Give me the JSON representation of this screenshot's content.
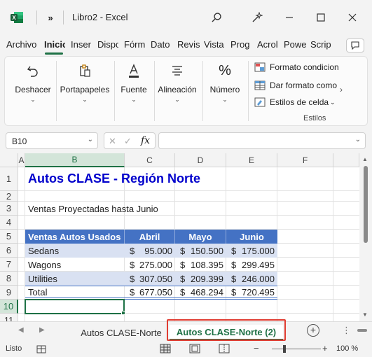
{
  "window": {
    "more_label": "»",
    "title": "Libro2  -  Excel",
    "app_icon_letter": "X"
  },
  "menu": {
    "tabs": [
      "Archivo",
      "Inicio",
      "Inser",
      "Dispo",
      "Fórm",
      "Dato",
      "Revis",
      "Vista",
      "Prog",
      "Acrol",
      "Powe",
      "Scrip"
    ],
    "active": "Inicio"
  },
  "ribbon": {
    "groups": [
      {
        "label": "Deshacer",
        "icon": "undo-icon"
      },
      {
        "label": "Portapapeles",
        "icon": "clipboard-icon"
      },
      {
        "label": "Fuente",
        "icon": "font-color-icon"
      },
      {
        "label": "Alineación",
        "icon": "align-icon"
      },
      {
        "label": "Número",
        "icon": "percent-icon"
      }
    ],
    "styles": {
      "conditional_format": "Formato condicion",
      "format_as_table": "Dar formato como",
      "cell_styles": "Estilos de celda",
      "caption": "Estilos"
    }
  },
  "formula_bar": {
    "name_box": "B10",
    "fx": "fx",
    "cancel": "✕",
    "enter": "✓",
    "formula": ""
  },
  "grid": {
    "columns": [
      "A",
      "B",
      "C",
      "D",
      "E",
      "F"
    ],
    "selected_column": "B",
    "rows": [
      "1",
      "2",
      "3",
      "4",
      "5",
      "6",
      "7",
      "8",
      "9",
      "10",
      "11"
    ],
    "selected_row": "10"
  },
  "sheet": {
    "title": "Autos CLASE - Región Norte",
    "subtitle": "Ventas Proyectadas hasta Junio",
    "table": {
      "headers": [
        "Ventas Autos Usados",
        "Abril",
        "Mayo",
        "Junio"
      ],
      "rows": [
        {
          "label": "Sedans",
          "values": [
            "95.000",
            "150.500",
            "175.000"
          ]
        },
        {
          "label": "Wagons",
          "values": [
            "275.000",
            "108.395",
            "299.495"
          ]
        },
        {
          "label": "Utilities",
          "values": [
            "307.050",
            "209.399",
            "246.000"
          ]
        },
        {
          "label": "Total",
          "values": [
            "677.050",
            "468.294",
            "720.495"
          ]
        }
      ],
      "currency": "$"
    }
  },
  "tabs": {
    "sheets": [
      "Autos CLASE-Norte",
      "Autos CLASE-Norte (2)"
    ],
    "active": "Autos CLASE-Norte (2)",
    "add": "+",
    "more": "⋮"
  },
  "status": {
    "text": "Listo",
    "zoom": "100 %",
    "zoom_minus": "−",
    "zoom_plus": "+"
  },
  "colors": {
    "excel_green": "#1e7145",
    "header_blue": "#4472c4",
    "band_blue": "#d9e1f2",
    "title_blue": "#0000cc",
    "highlight_red": "#e03c31"
  }
}
